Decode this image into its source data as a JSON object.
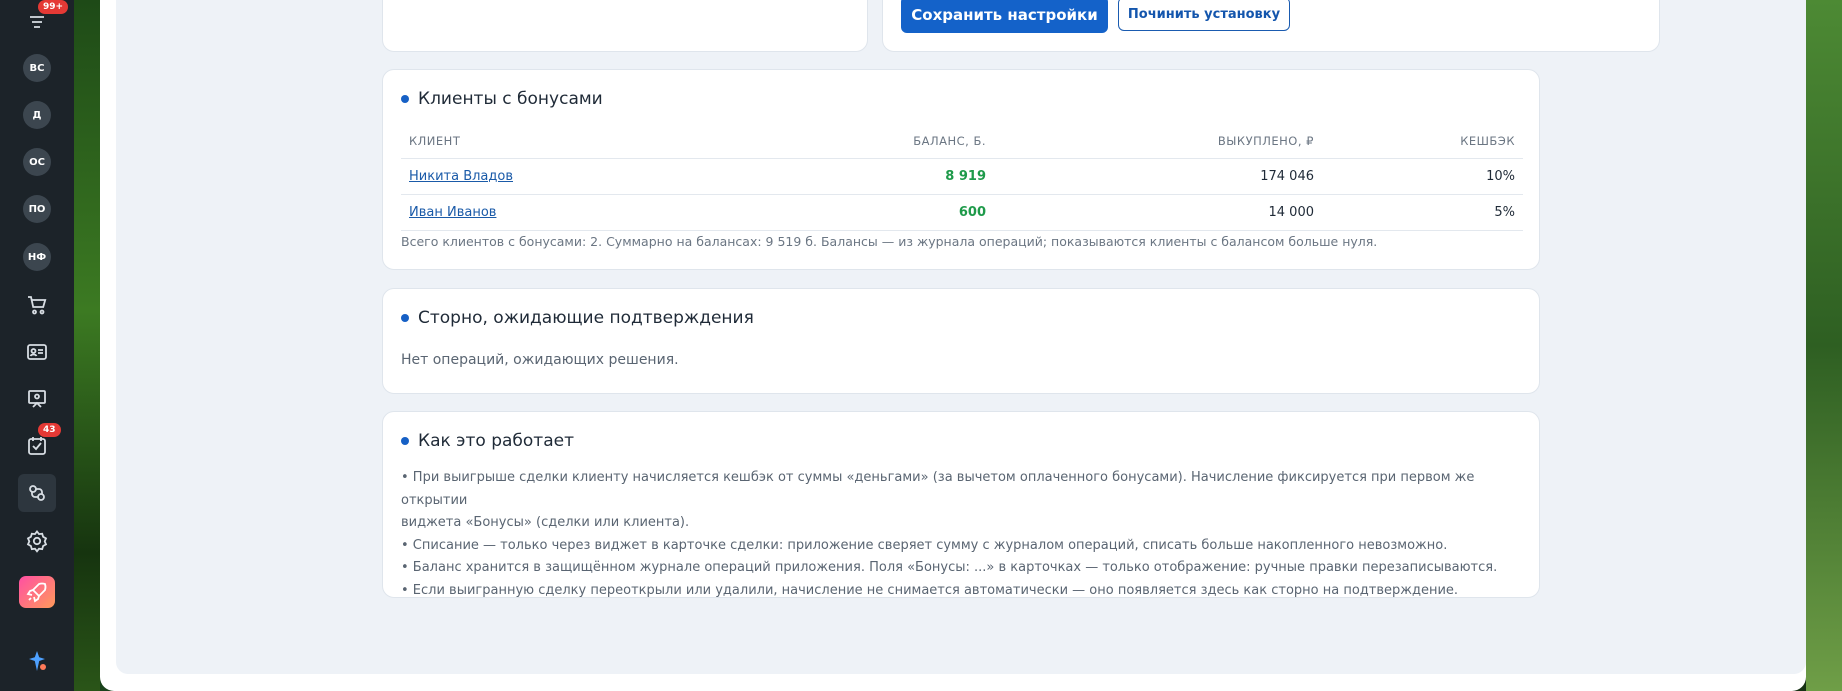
{
  "sidebar": {
    "items": [
      {
        "kind": "icon",
        "icon": "list-icon",
        "badge": "99+"
      },
      {
        "kind": "avatar",
        "label": "ВС"
      },
      {
        "kind": "avatar",
        "label": "Д"
      },
      {
        "kind": "avatar",
        "label": "ОС"
      },
      {
        "kind": "avatar",
        "label": "ПО"
      },
      {
        "kind": "avatar",
        "label": "НФ"
      },
      {
        "kind": "icon",
        "icon": "cart-icon"
      },
      {
        "kind": "icon",
        "icon": "contact-card-icon"
      },
      {
        "kind": "icon",
        "icon": "presentation-icon"
      },
      {
        "kind": "icon",
        "icon": "task-check-icon",
        "badge": "43"
      },
      {
        "kind": "icon",
        "icon": "integrations-icon",
        "active": true
      },
      {
        "kind": "icon",
        "icon": "gear-icon"
      },
      {
        "kind": "icon",
        "icon": "rocket-icon"
      },
      {
        "kind": "icon",
        "icon": "sparkle-icon"
      }
    ]
  },
  "actions": {
    "save_label": "Сохранить настройки",
    "repair_label": "Починить установку"
  },
  "clients": {
    "title": "Клиенты с бонусами",
    "columns": [
      "КЛИЕНТ",
      "БАЛАНС, Б.",
      "ВЫКУПЛЕНО, ₽",
      "КЕШБЭК"
    ],
    "rows": [
      {
        "name": "Никита Владов",
        "balance": "8 919",
        "purchased": "174 046",
        "cashback": "10%"
      },
      {
        "name": "Иван Иванов",
        "balance": "600",
        "purchased": "14 000",
        "cashback": "5%"
      }
    ],
    "summary": "Всего клиентов с бонусами: 2. Суммарно на балансах: 9 519 б. Балансы — из журнала операций; показываются клиенты с балансом больше нуля."
  },
  "storno": {
    "title": "Сторно, ожидающие подтверждения",
    "empty_text": "Нет операций, ожидающих решения."
  },
  "how": {
    "title": "Как это работает",
    "lines": [
      "• При выигрыше сделки клиенту начисляется кешбэк от суммы «деньгами» (за вычетом оплаченного бонусами). Начисление фиксируется при первом же открытии",
      "виджета «Бонусы» (сделки или клиента).",
      "• Списание — только через виджет в карточке сделки: приложение сверяет сумму с журналом операций, списать больше накопленного невозможно.",
      "• Баланс хранится в защищённом журнале операций приложения. Поля «Бонусы: ...» в карточках — только отображение: ручные правки перезаписываются.",
      "• Если выигранную сделку переоткрыли или удалили, начисление не снимается автоматически — оно появляется здесь как сторно на подтверждение."
    ]
  },
  "colors": {
    "accent": "#1462c9",
    "positive": "#1e9a4a",
    "sidebar_bg": "#1c2329"
  }
}
